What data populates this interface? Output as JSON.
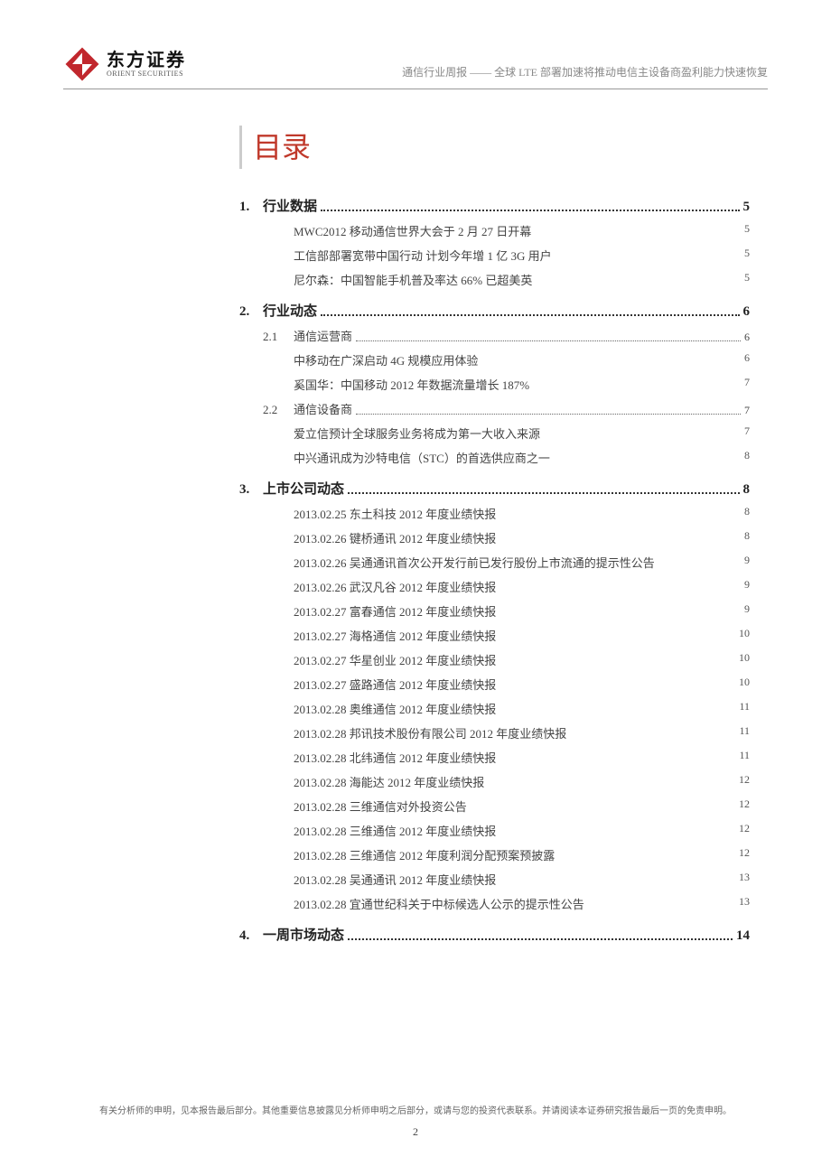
{
  "header": {
    "logo_cn": "东方证券",
    "logo_en": "ORIENT SECURITIES",
    "title": "通信行业周报 —— 全球 LTE 部署加速将推动电信主设备商盈利能力快速恢复"
  },
  "toc": {
    "title": "目录",
    "sections": [
      {
        "num": "1.",
        "title": "行业数据",
        "page": "5",
        "items": [
          {
            "text": "MWC2012 移动通信世界大会于 2 月 27 日开幕",
            "page": "5"
          },
          {
            "text": "工信部部署宽带中国行动 计划今年增 1 亿 3G 用户",
            "page": "5"
          },
          {
            "text": "尼尔森：中国智能手机普及率达 66% 已超美英",
            "page": "5"
          }
        ]
      },
      {
        "num": "2.",
        "title": "行业动态",
        "page": "6",
        "subsections": [
          {
            "num": "2.1",
            "title": "通信运营商",
            "page": "6",
            "items": [
              {
                "text": "中移动在广深启动 4G 规模应用体验",
                "page": "6"
              },
              {
                "text": "奚国华：中国移动 2012 年数据流量增长 187%",
                "page": "7"
              }
            ]
          },
          {
            "num": "2.2",
            "title": "通信设备商",
            "page": "7",
            "items": [
              {
                "text": "爱立信预计全球服务业务将成为第一大收入来源",
                "page": "7"
              },
              {
                "text": "中兴通讯成为沙特电信（STC）的首选供应商之一",
                "page": "8"
              }
            ]
          }
        ]
      },
      {
        "num": "3.",
        "title": "上市公司动态",
        "page": "8",
        "items": [
          {
            "text": "2013.02.25 东土科技 2012 年度业绩快报",
            "page": "8"
          },
          {
            "text": "2013.02.26 键桥通讯 2012 年度业绩快报",
            "page": "8"
          },
          {
            "text": "2013.02.26 吴通通讯首次公开发行前已发行股份上市流通的提示性公告",
            "page": "9"
          },
          {
            "text": "2013.02.26 武汉凡谷 2012 年度业绩快报",
            "page": "9"
          },
          {
            "text": "2013.02.27 富春通信 2012 年度业绩快报",
            "page": "9"
          },
          {
            "text": "2013.02.27 海格通信 2012 年度业绩快报",
            "page": "10"
          },
          {
            "text": "2013.02.27 华星创业 2012 年度业绩快报",
            "page": "10"
          },
          {
            "text": "2013.02.27 盛路通信 2012 年度业绩快报",
            "page": "10"
          },
          {
            "text": "2013.02.28 奥维通信 2012 年度业绩快报",
            "page": "11"
          },
          {
            "text": "2013.02.28 邦讯技术股份有限公司 2012 年度业绩快报",
            "page": "11"
          },
          {
            "text": "2013.02.28 北纬通信 2012 年度业绩快报",
            "page": "11"
          },
          {
            "text": "2013.02.28 海能达 2012 年度业绩快报",
            "page": "12"
          },
          {
            "text": "2013.02.28 三维通信对外投资公告",
            "page": "12"
          },
          {
            "text": "2013.02.28 三维通信 2012 年度业绩快报",
            "page": "12"
          },
          {
            "text": "2013.02.28 三维通信 2012 年度利润分配预案预披露",
            "page": "12"
          },
          {
            "text": "2013.02.28 吴通通讯 2012 年度业绩快报",
            "page": "13"
          },
          {
            "text": "2013.02.28 宜通世纪科关于中标候选人公示的提示性公告",
            "page": "13"
          }
        ]
      },
      {
        "num": "4.",
        "title": "一周市场动态",
        "page": "14"
      }
    ]
  },
  "footer": {
    "disclaimer": "有关分析师的申明，见本报告最后部分。其他重要信息披露见分析师申明之后部分，或请与您的投资代表联系。并请阅读本证券研究报告最后一页的免责申明。",
    "page_num": "2"
  }
}
